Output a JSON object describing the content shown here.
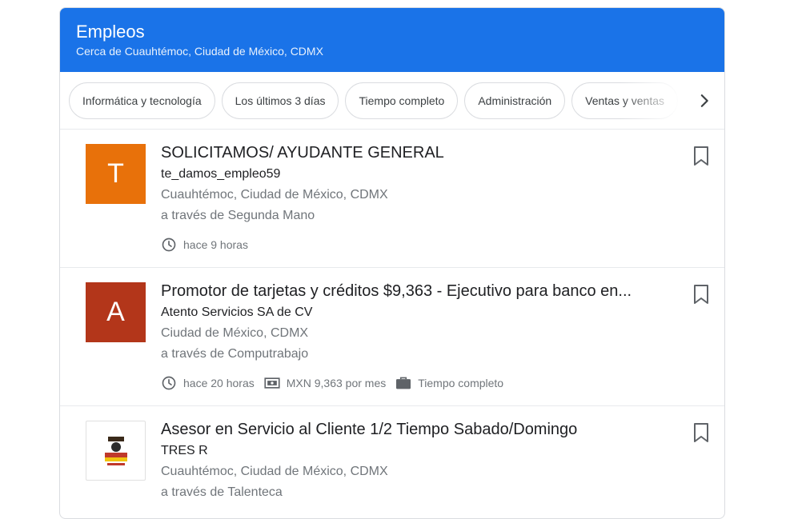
{
  "header": {
    "title": "Empleos",
    "subtitle": "Cerca de Cuauhtémoc, Ciudad de México, CDMX"
  },
  "colors": {
    "header_bg": "#1a73e8",
    "logo_t": "#e8710a",
    "logo_a": "#b3361a"
  },
  "filters": [
    {
      "label": "Informática y tecnología"
    },
    {
      "label": "Los últimos 3 días"
    },
    {
      "label": "Tiempo completo"
    },
    {
      "label": "Administración"
    },
    {
      "label": "Ventas y ventas"
    }
  ],
  "jobs": [
    {
      "logo_letter": "T",
      "title": "SOLICITAMOS/ AYUDANTE GENERAL",
      "company": "te_damos_empleo59",
      "location": "Cuauhtémoc, Ciudad de México, CDMX",
      "via": "a través de Segunda Mano",
      "posted": "hace 9 horas"
    },
    {
      "logo_letter": "A",
      "title": "Promotor de tarjetas y créditos $9,363 - Ejecutivo para banco en...",
      "company": "Atento Servicios SA de CV",
      "location": "Ciudad de México, CDMX",
      "via": "a través de Computrabajo",
      "posted": "hace 20 horas",
      "salary": "MXN 9,363 por mes",
      "schedule": "Tiempo completo"
    },
    {
      "title": "Asesor en Servicio al Cliente 1/2 Tiempo Sabado/Domingo",
      "company": "TRES R",
      "location": "Cuauhtémoc, Ciudad de México, CDMX",
      "via": "a través de Talenteca"
    }
  ]
}
